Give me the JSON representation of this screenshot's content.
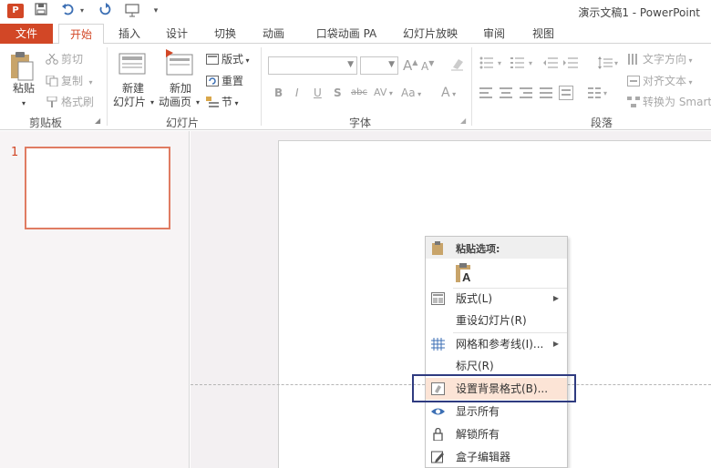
{
  "window": {
    "title": "演示文稿1 - PowerPoint",
    "app_icon_letter": "P"
  },
  "quick_access": [
    "save-icon",
    "undo-icon",
    "redo-icon",
    "slideshow-icon"
  ],
  "tabs": {
    "file": "文件",
    "home": "开始",
    "insert": "插入",
    "design": "设计",
    "transitions": "切换",
    "animations": "动画",
    "pocket_animation": "口袋动画 PA",
    "slideshow": "幻灯片放映",
    "review": "审阅",
    "view": "视图"
  },
  "ribbon": {
    "clipboard": {
      "label": "剪贴板",
      "paste": "粘贴",
      "cut": "剪切",
      "copy": "复制",
      "format_painter": "格式刷"
    },
    "slides": {
      "label": "幻灯片",
      "new_slide_1": "新建",
      "new_slide_2": "幻灯片",
      "new_anim_1": "新加",
      "new_anim_2": "动画页",
      "layout": "版式",
      "reset": "重置",
      "section": "节"
    },
    "font": {
      "label": "字体",
      "bold": "B",
      "italic": "I",
      "underline": "U",
      "shadow": "S",
      "strike": "abc",
      "spacing": "AV",
      "case": "Aa",
      "color": "A",
      "grow": "A",
      "shrink": "A"
    },
    "paragraph": {
      "label": "段落",
      "text_direction": "文字方向",
      "align_text": "对齐文本",
      "convert_smartart": "转换为 Smart"
    }
  },
  "slides_pane": {
    "slide_number": "1"
  },
  "context_menu": {
    "paste_options": "粘贴选项:",
    "items": [
      {
        "label": "版式(L)",
        "submenu": true
      },
      {
        "label": "重设幻灯片(R)",
        "submenu": false
      },
      {
        "label": "网格和参考线(I)...",
        "submenu": true
      },
      {
        "label": "标尺(R)",
        "submenu": false
      },
      {
        "label": "设置背景格式(B)...",
        "submenu": false
      },
      {
        "label": "显示所有",
        "submenu": false
      },
      {
        "label": "解锁所有",
        "submenu": false
      },
      {
        "label": "盒子编辑器",
        "submenu": false
      }
    ]
  },
  "colors": {
    "accent": "#d24726",
    "highlight": "#fce4d6",
    "focus_box": "#2f3b80"
  }
}
